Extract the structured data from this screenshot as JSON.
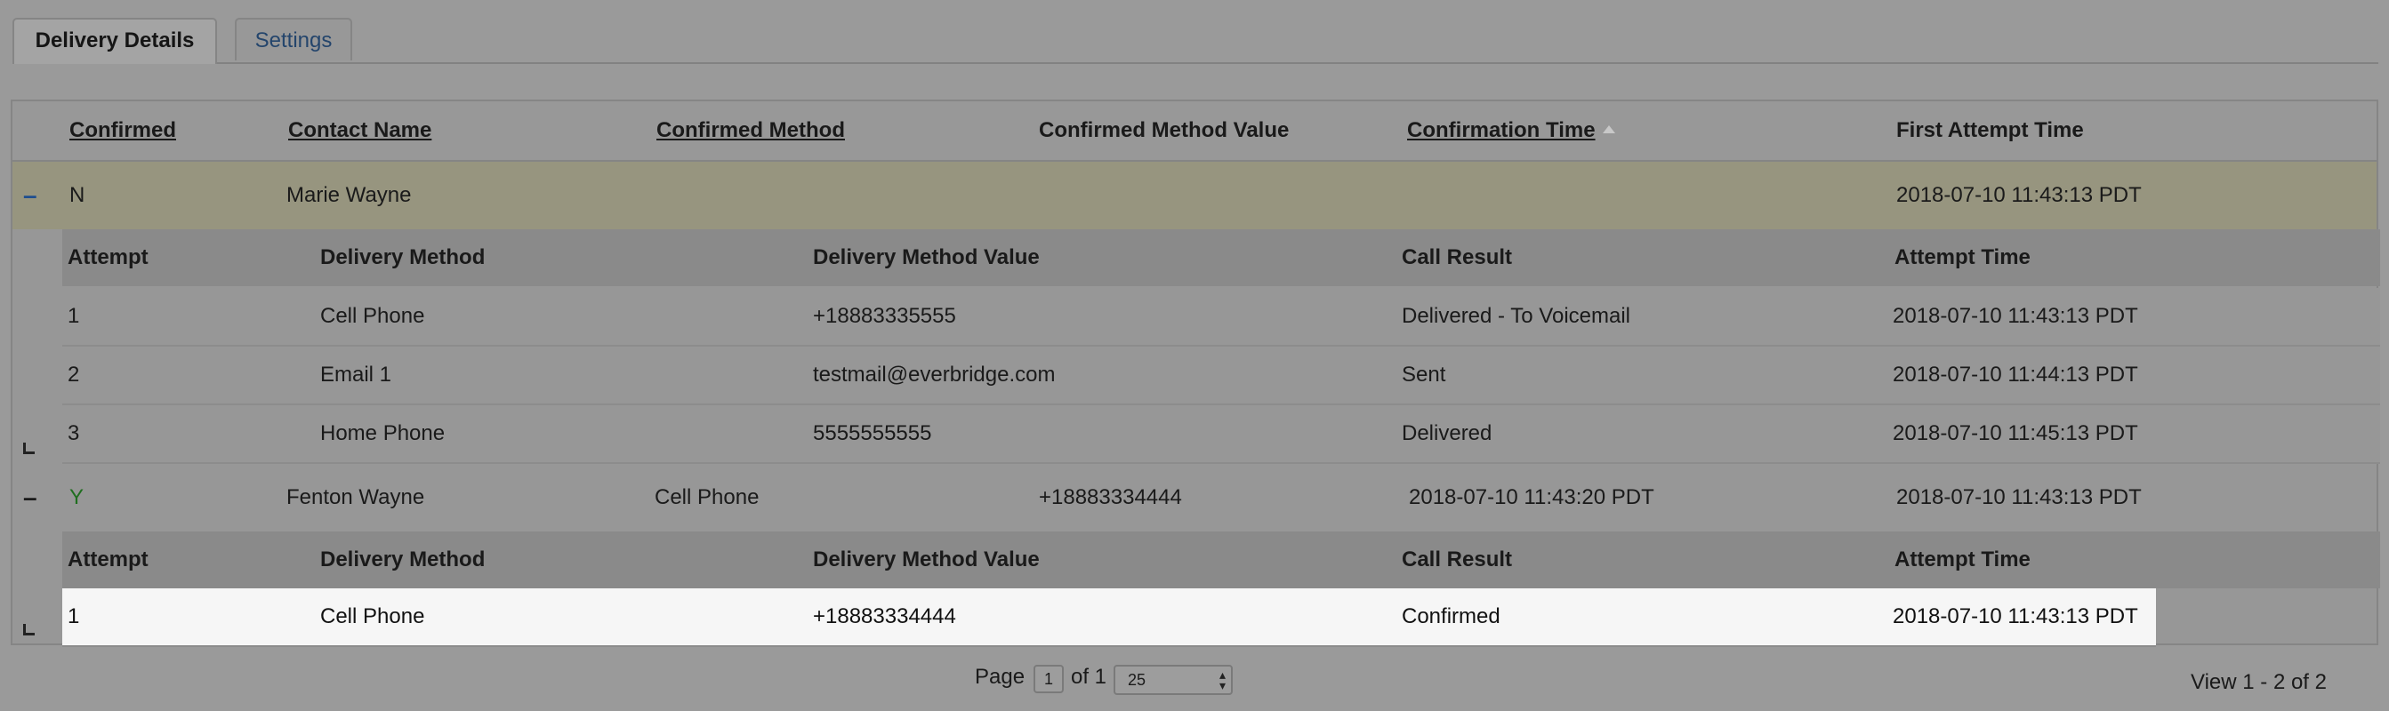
{
  "tabs": [
    {
      "label": "Delivery Details"
    },
    {
      "label": "Settings"
    }
  ],
  "columns": {
    "confirmed": "Confirmed",
    "contact_name": "Contact Name",
    "confirmed_method": "Confirmed Method",
    "confirmed_method_value": "Confirmed Method Value",
    "confirmation_time": "Confirmation Time",
    "first_attempt_time": "First Attempt Time"
  },
  "sub_columns": {
    "attempt": "Attempt",
    "delivery_method": "Delivery Method",
    "delivery_method_value": "Delivery Method Value",
    "call_result": "Call Result",
    "attempt_time": "Attempt Time"
  },
  "rows": [
    {
      "expander": "–",
      "confirmed": "N",
      "contact_name": "Marie Wayne",
      "confirmed_method": "",
      "confirmed_method_value": "",
      "confirmation_time": "",
      "first_attempt_time": "2018-07-10 11:43:13 PDT",
      "attempts": [
        {
          "attempt": "1",
          "delivery_method": "Cell Phone",
          "delivery_method_value": "+18883335555",
          "call_result": "Delivered - To Voicemail",
          "attempt_time": "2018-07-10 11:43:13 PDT"
        },
        {
          "attempt": "2",
          "delivery_method": "Email 1",
          "delivery_method_value": "testmail@everbridge.com",
          "call_result": "Sent",
          "attempt_time": "2018-07-10 11:44:13 PDT"
        },
        {
          "attempt": "3",
          "delivery_method": "Home Phone",
          "delivery_method_value": "5555555555",
          "call_result": "Delivered",
          "attempt_time": "2018-07-10 11:45:13 PDT"
        }
      ]
    },
    {
      "expander": "–",
      "confirmed": "Y",
      "contact_name": "Fenton Wayne",
      "confirmed_method": "Cell Phone",
      "confirmed_method_value": "+18883334444",
      "confirmation_time": "2018-07-10 11:43:20 PDT",
      "first_attempt_time": "2018-07-10 11:43:13 PDT",
      "attempts": [
        {
          "attempt": "1",
          "delivery_method": "Cell Phone",
          "delivery_method_value": "+18883334444",
          "call_result": "Confirmed",
          "attempt_time": "2018-07-10 11:43:13 PDT"
        }
      ]
    }
  ],
  "pager": {
    "page_label": "Page",
    "page_value": "1",
    "of_label": "of 1",
    "per_page": "25",
    "view_info": "View 1 - 2 of 2"
  }
}
